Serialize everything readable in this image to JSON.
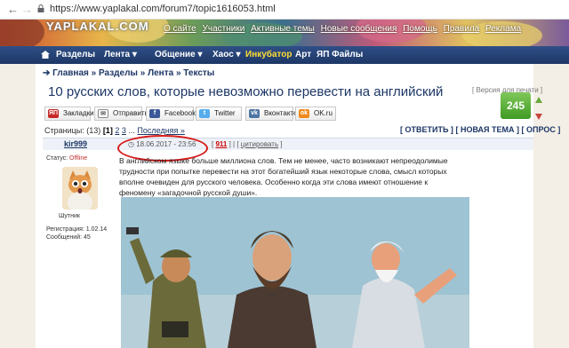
{
  "browser": {
    "url": "https://www.yaplakal.com/forum7/topic1616053.html"
  },
  "site": {
    "logo": "YAPLAKAL.COM",
    "top_links": [
      "О сайте",
      "Участники",
      "Активные темы",
      "Новые сообщения",
      "Помощь",
      "Правила",
      "Реклама"
    ]
  },
  "nav": {
    "items": [
      "Разделы",
      "Лента ▾",
      "Общение ▾",
      "Хаос ▾",
      "Инкубатор",
      "Арт",
      "ЯП Файлы"
    ]
  },
  "breadcrumb": {
    "items": [
      "Главная",
      "Разделы",
      "Лента",
      "Тексты"
    ],
    "separator": "»"
  },
  "topic": {
    "title": "10 русских слов, которые невозможно перевести на английский",
    "print_version": "[ Версия для печати ]"
  },
  "share": {
    "buttons": [
      {
        "label": "Закладки",
        "icon": "yap-icon"
      },
      {
        "label": "Отправить",
        "icon": "mail-icon"
      },
      {
        "label": "Facebook",
        "icon": "facebook-icon"
      },
      {
        "label": "Twitter",
        "icon": "twitter-icon"
      },
      {
        "label": "Вконтакте",
        "icon": "vk-icon"
      },
      {
        "label": "OK.ru",
        "icon": "ok-icon"
      }
    ]
  },
  "pager": {
    "label": "Страницы:",
    "total": "(13)",
    "current": "[1]",
    "pages": [
      "2",
      "3"
    ],
    "dots": "...",
    "last": "Последняя »"
  },
  "actions": {
    "reply": "[ ОТВЕТИТЬ ]",
    "new_topic": "[ НОВАЯ ТЕМА ]",
    "poll": "[ ОПРОС ]"
  },
  "post": {
    "author": "kir999",
    "date": "18.06.2017 - 23:56",
    "number": "911",
    "cite": "цитировать",
    "status_label": "Статус:",
    "status_value": "Offline",
    "rank": "Шутник",
    "registration": "Регистрация: 1.02.14",
    "messages": "Сообщений: 45",
    "text": "В английском языке больше миллиона слов. Тем не менее, часто возникают непреодолимые трудности при попытке перевести на этот богатейший язык некоторые слова, смысл которых вполне очевиден для русского человека. Особенно когда эти слова имеют отношение к феномену «загадочной русской души».",
    "rating": "245"
  },
  "colors": {
    "nav_bg": "#1d3766",
    "link": "#1d3766",
    "rating_green": "#3f9a23",
    "highlight_circle": "#d81a1a",
    "offline": "#c03030"
  }
}
